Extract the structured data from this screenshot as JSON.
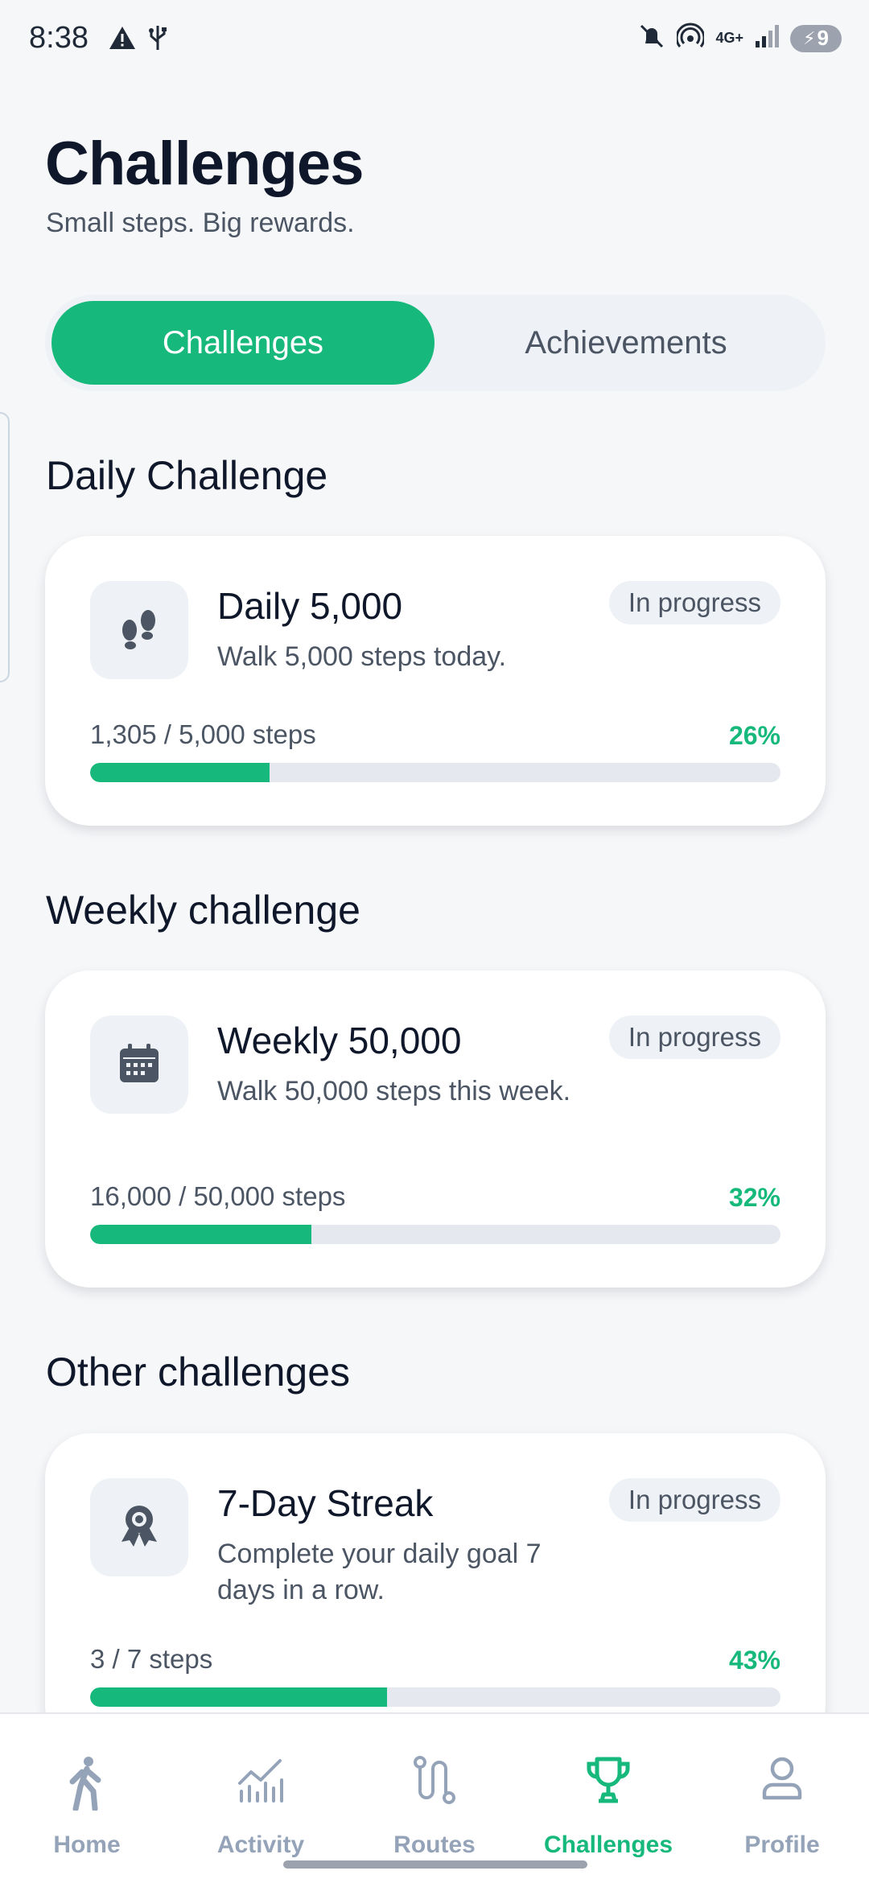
{
  "status_bar": {
    "time": "8:38",
    "network": "4G+",
    "battery": "9"
  },
  "header": {
    "title": "Challenges",
    "subtitle": "Small steps. Big rewards."
  },
  "tabs": [
    {
      "label": "Challenges",
      "active": true
    },
    {
      "label": "Achievements",
      "active": false
    }
  ],
  "sections": [
    {
      "title": "Daily Challenge",
      "card": {
        "icon": "footprints-icon",
        "title": "Daily 5,000",
        "description": "Walk 5,000 steps today.",
        "status": "In progress",
        "progress_label": "1,305 / 5,000 steps",
        "progress_percent_label": "26%",
        "progress_fraction": 0.26
      }
    },
    {
      "title": "Weekly challenge",
      "card": {
        "icon": "calendar-icon",
        "title": "Weekly 50,000",
        "description": "Walk 50,000 steps this week.",
        "status": "In progress",
        "progress_label": "16,000 / 50,000 steps",
        "progress_percent_label": "32%",
        "progress_fraction": 0.32
      }
    },
    {
      "title": "Other challenges",
      "card": {
        "icon": "award-ribbon-icon",
        "title": "7-Day Streak",
        "description": "Complete your daily goal 7 days in a row.",
        "status": "In progress",
        "progress_label": "3 / 7 steps",
        "progress_percent_label": "43%",
        "progress_fraction": 0.43
      }
    }
  ],
  "bottom_nav": [
    {
      "label": "Home",
      "icon": "walking-person-icon",
      "active": false
    },
    {
      "label": "Activity",
      "icon": "activity-chart-icon",
      "active": false
    },
    {
      "label": "Routes",
      "icon": "route-icon",
      "active": false
    },
    {
      "label": "Challenges",
      "icon": "trophy-icon",
      "active": true
    },
    {
      "label": "Profile",
      "icon": "user-icon",
      "active": false
    }
  ],
  "colors": {
    "accent": "#16b97b",
    "background": "#f6f7f9",
    "muted_text": "#4b5563",
    "inactive_nav": "#94a3b8"
  }
}
